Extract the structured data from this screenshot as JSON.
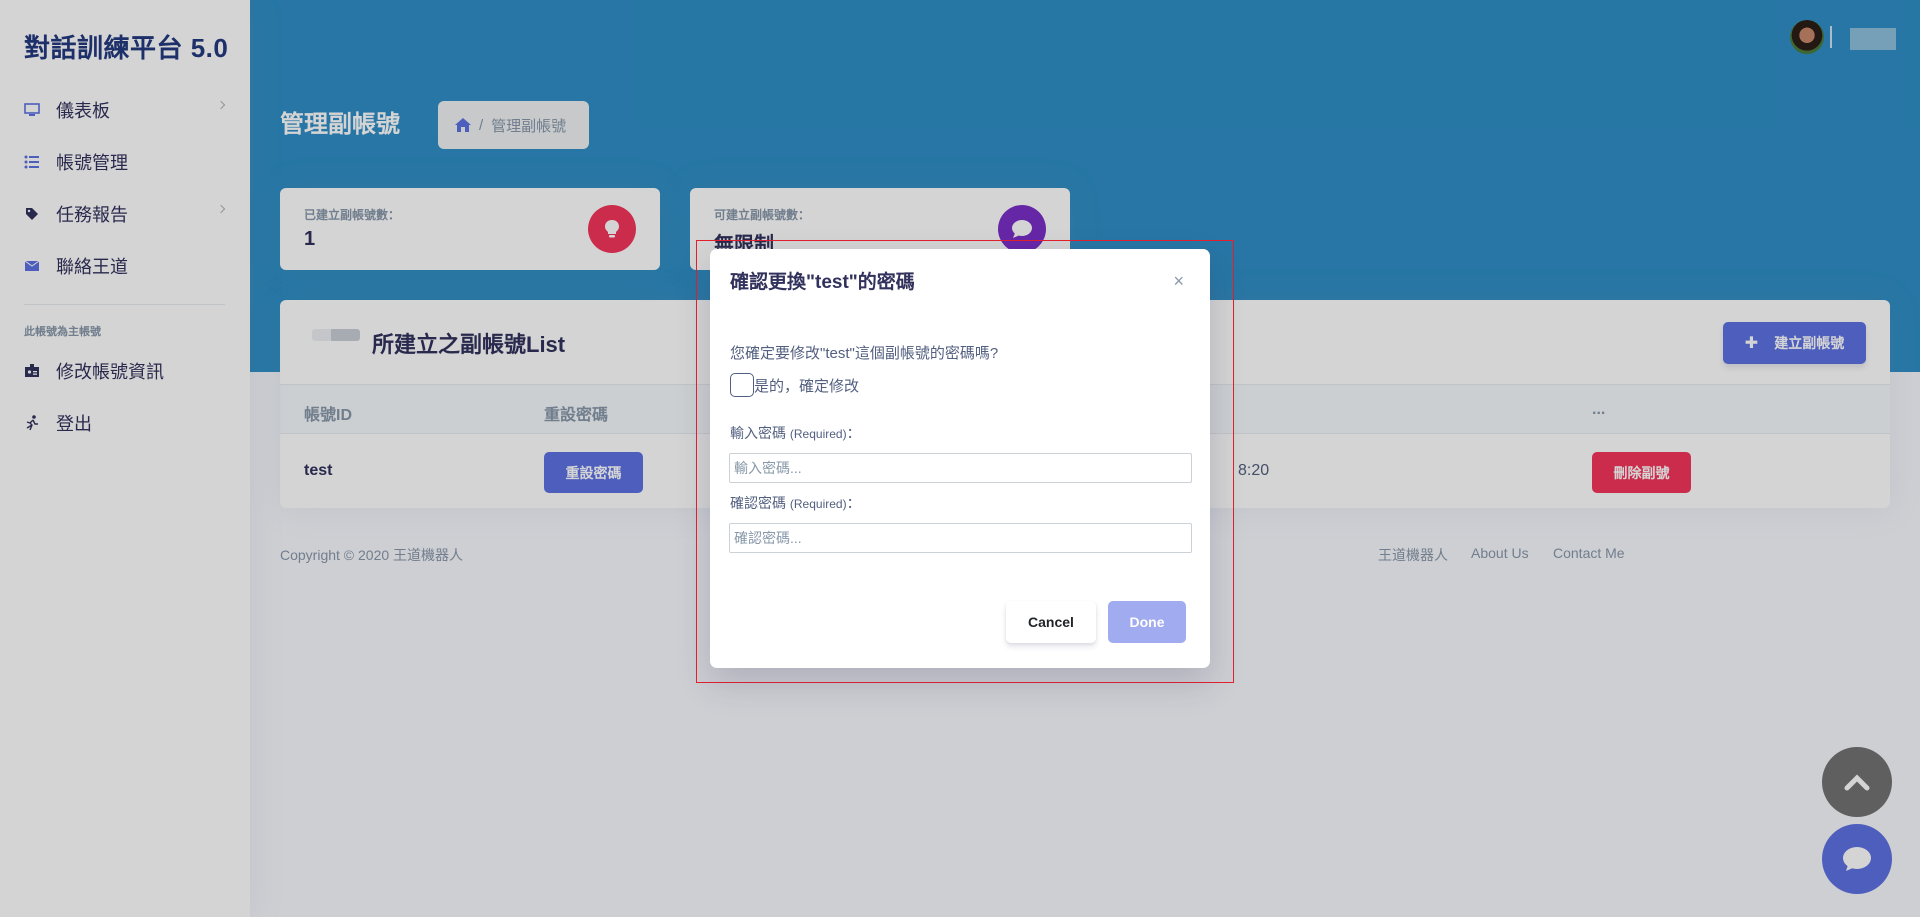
{
  "app": {
    "brand": "對話訓練平台 5.0"
  },
  "sidebar": {
    "items": [
      {
        "label": "儀表板",
        "icon": "monitor-icon",
        "has_submenu": true
      },
      {
        "label": "帳號管理",
        "icon": "list-icon",
        "has_submenu": false
      },
      {
        "label": "任務報告",
        "icon": "tag-icon",
        "has_submenu": true
      },
      {
        "label": "聯絡王道",
        "icon": "envelope-icon",
        "has_submenu": false
      }
    ],
    "section_heading": "此帳號為主帳號",
    "items2": [
      {
        "label": "修改帳號資訊",
        "icon": "id-card-icon"
      },
      {
        "label": "登出",
        "icon": "running-icon"
      }
    ]
  },
  "page": {
    "title": "管理副帳號",
    "breadcrumb_current": "管理副帳號",
    "breadcrumb_sep": "/"
  },
  "stats": [
    {
      "label": "已建立副帳號數：",
      "value": "1",
      "icon": "lightbulb-icon",
      "color": "#f5365c"
    },
    {
      "label": "可建立副帳號數：",
      "value": "無限制",
      "icon": "chat-icon",
      "color": "#8965e0"
    }
  ],
  "list": {
    "title": "所建立之副帳號List",
    "add_button": "建立副帳號",
    "columns": [
      "帳號ID",
      "重設密碼",
      "..."
    ],
    "rows": [
      {
        "id": "test",
        "reset_label": "重設密碼",
        "time_partial": "8:20",
        "delete_label": "刪除副號"
      }
    ]
  },
  "footer": {
    "copyright": "Copyright © 2020 王道機器人",
    "links": [
      "王道機器人",
      "About Us",
      "Contact Me"
    ]
  },
  "modal": {
    "title": "確認更換\"test\"的密碼",
    "close": "×",
    "question": "您確定要修改\"test\"這個副帳號的密碼嗎?",
    "checkbox_label": "是的，確定修改",
    "password_label": "輸入密碼",
    "password_placeholder": "輸入密碼...",
    "confirm_label": "確認密碼",
    "confirm_placeholder": "確認密碼...",
    "required": "(Required)",
    "colon": "：",
    "cancel": "Cancel",
    "done": "Done"
  },
  "colors": {
    "primary": "#5e72e4",
    "header": "#2f8fc7",
    "danger": "#f5365c",
    "fab_top": "#737373",
    "fab_chat": "#5e72e4"
  }
}
